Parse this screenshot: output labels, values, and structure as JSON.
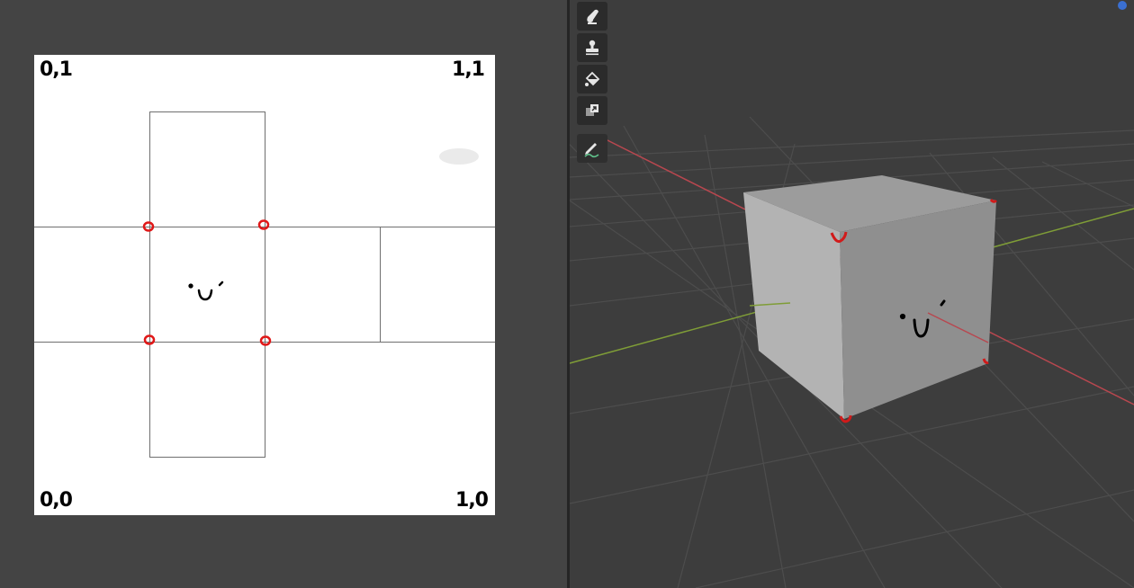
{
  "uv_editor": {
    "corner_labels": {
      "top_left": "0,1",
      "top_right": "1,1",
      "bottom_left": "0,0",
      "bottom_right": "1,0"
    },
    "face_drawing": "·∪·"
  },
  "viewport": {
    "toolbar": [
      {
        "name": "draw-brush-icon"
      },
      {
        "name": "clone-stamp-icon"
      },
      {
        "name": "fill-bucket-icon"
      },
      {
        "name": "mask-icon"
      },
      {
        "name": "annotate-pen-icon"
      }
    ],
    "axis_colors": {
      "x": "#b8474f",
      "y": "#7f9d37"
    },
    "cube_marker_color": "#d11a1a"
  },
  "colors": {
    "uv_bg": "#444444",
    "viewport_bg": "#3d3d3d",
    "grid": "#4d4d4d",
    "uv_marker": "#e01818"
  }
}
